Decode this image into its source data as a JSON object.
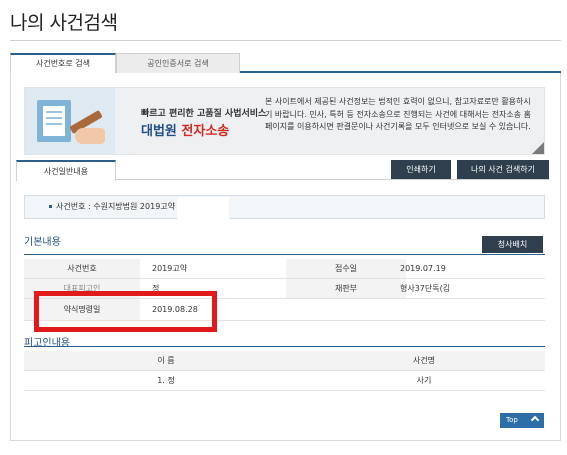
{
  "page_title": "나의 사건검색",
  "main_tabs": [
    {
      "label": "사건번호로 검색",
      "active": true
    },
    {
      "label": "공인인증서로 검색",
      "active": false
    }
  ],
  "banner": {
    "subtitle": "빠르고 편리한 고품질 사법서비스",
    "brand_blue": "대법원",
    "brand_red": "전자소송",
    "note": "본 사이트에서 제공된 사건정보는 법적인 효력이 없으니, 참고자료로만 활용하시기 바랍니다. 민사, 특허 등 전자소송으로 진행되는 사건에 대해서는 전자소송 홈페이지를 이용하시면 판결문이나 사건기록을 모두 인터넷으로 보실 수 있습니다."
  },
  "sub_tab": "사건일반내용",
  "buttons": {
    "print": "인쇄하기",
    "my_case": "나의 사건 검색하기",
    "send": "청사배치",
    "top": "Top"
  },
  "case_line": "사건번호 : 수원지방법원 2019고약",
  "basic_section": {
    "title": "기본내용",
    "rows": [
      {
        "label1": "사건번호",
        "value1": "2019고약",
        "label2": "접수일",
        "value2": "2019.07.19"
      },
      {
        "label1": "대표피고인",
        "value1": "정",
        "label2": "재판부",
        "value2": "형사37단독(김"
      },
      {
        "label1": "약식명령일",
        "value1": "2019.08.28",
        "label2": "",
        "value2": ""
      }
    ]
  },
  "defendant_section": {
    "title": "피고인내용",
    "columns": [
      "이 름",
      "사건명"
    ],
    "rows": [
      {
        "name": "1. 정",
        "case_name": "사기"
      }
    ]
  },
  "colors": {
    "accent": "#2d5f8d",
    "dark_button": "#2f3f4e",
    "highlight": "#e01b1b",
    "brand_blue": "#1f4f86",
    "brand_red": "#d9271e"
  }
}
